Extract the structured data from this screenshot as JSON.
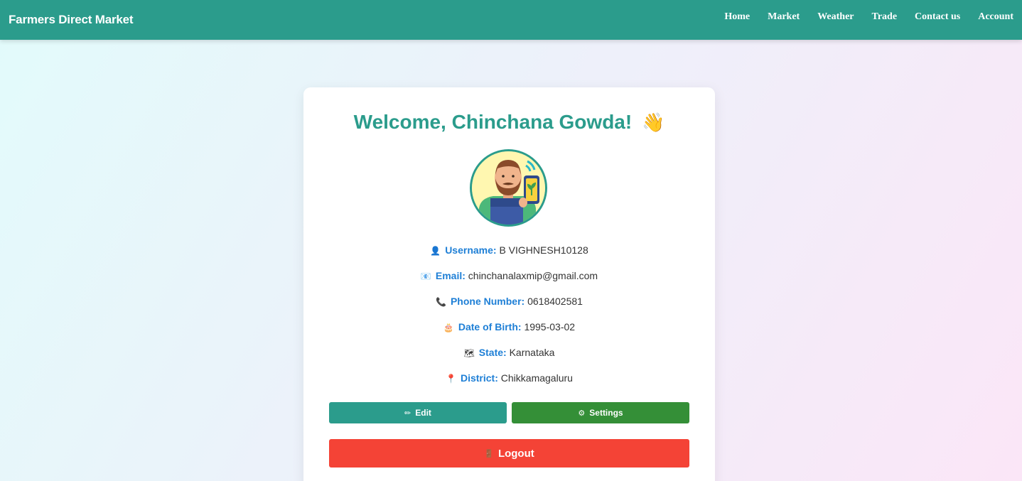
{
  "navbar": {
    "brand": "Farmers Direct Market",
    "links": [
      "Home",
      "Market",
      "Weather",
      "Trade",
      "Contact us",
      "Account"
    ]
  },
  "profile": {
    "welcome": "Welcome, Chinchana Gowda!",
    "wave_emoji": "👋",
    "fields": [
      {
        "icon": "👤",
        "icon_name": "user-icon",
        "label": "Username:",
        "value": "B VIGHNESH10128"
      },
      {
        "icon": "📧",
        "icon_name": "email-icon",
        "label": "Email:",
        "value": "chinchanalaxmip@gmail.com"
      },
      {
        "icon": "📞",
        "icon_name": "phone-icon",
        "label": "Phone Number:",
        "value": "0618402581"
      },
      {
        "icon": "🎂",
        "icon_name": "cake-icon",
        "label": "Date of Birth:",
        "value": "1995-03-02"
      },
      {
        "icon": "🗺",
        "icon_name": "map-icon",
        "label": "State:",
        "value": "Karnataka"
      },
      {
        "icon": "📍",
        "icon_name": "pin-icon",
        "label": "District:",
        "value": "Chikkamagaluru"
      }
    ]
  },
  "buttons": {
    "edit": {
      "icon": "✏",
      "label": "Edit"
    },
    "settings": {
      "icon": "⚙",
      "label": "Settings"
    },
    "logout": {
      "icon": "🚪",
      "label": "Logout"
    }
  },
  "colors": {
    "primary": "#2b9c8c",
    "label_blue": "#1e7fd6",
    "settings_green": "#348f37",
    "logout_red": "#f44336"
  }
}
